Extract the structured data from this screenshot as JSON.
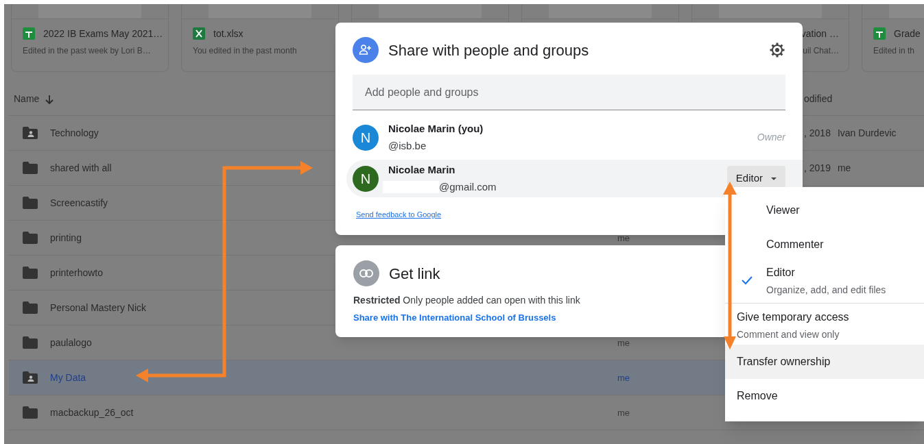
{
  "file_cards": [
    {
      "kind": "sheets_file",
      "title": "2022 IB Exams May 2021…",
      "subtitle": "Edited in the past week by Lori B…"
    },
    {
      "kind": "excel_file",
      "title": "tot.xlsx",
      "subtitle": "You edited in the past month"
    },
    {
      "kind": "covered"
    },
    {
      "kind": "covered"
    },
    {
      "kind": "partial",
      "title": "vation …",
      "subtitle": "uil Chat…"
    },
    {
      "kind": "sheets_file",
      "title": "Grade",
      "subtitle": "Edited in th"
    }
  ],
  "columns": [
    {
      "label": "Name",
      "sorted": true
    },
    {
      "label": "odified",
      "sorted": false
    }
  ],
  "rows": [
    {
      "name": "Technology",
      "kind": "shared_folder",
      "selected": false,
      "modified": ", 2018",
      "modified_by": "Ivan Durdevic"
    },
    {
      "name": "shared with all",
      "kind": "folder",
      "selected": false,
      "modified": ", 2019",
      "modified_by": "me"
    },
    {
      "name": "Screencastify",
      "kind": "folder",
      "selected": false
    },
    {
      "name": "printing",
      "kind": "folder",
      "selected": false,
      "owner": "me"
    },
    {
      "name": "printerhowto",
      "kind": "folder",
      "selected": false
    },
    {
      "name": "Personal Mastery Nick",
      "kind": "folder",
      "selected": false
    },
    {
      "name": "paulalogo",
      "kind": "folder",
      "selected": false,
      "owner": "me"
    },
    {
      "name": "My Data",
      "kind": "shared_folder",
      "selected": true,
      "owner": "me"
    },
    {
      "name": "macbackup_26_oct",
      "kind": "folder",
      "selected": false,
      "owner": "me"
    }
  ],
  "share_dialog": {
    "title": "Share with people and groups",
    "add_field": {
      "placeholder": "Add people and groups"
    },
    "people": [
      {
        "initial": "N",
        "color": "#1a88d6",
        "name": "Nicolae Marin (you)",
        "email": "@isb.be",
        "kind": "owner",
        "role": "Owner",
        "selected": false
      },
      {
        "initial": "N",
        "color": "#2d6a1f",
        "name": "Nicolae Marin",
        "email": "@gmail.com",
        "email_redacted": true,
        "kind": "collaborator",
        "role": "Editor",
        "selected": true
      }
    ],
    "feedback_link": "Send feedback to Google"
  },
  "link_dialog": {
    "title": "Get link",
    "description": "**Restricted** Only people added can open with this link",
    "share_link": "Share with The International School of Brussels"
  },
  "role_menu": {
    "items": [
      {
        "kind": "role",
        "label": "Viewer",
        "selected": false,
        "highlighted": false,
        "divider_before": false
      },
      {
        "kind": "role",
        "label": "Commenter",
        "selected": false,
        "highlighted": false,
        "divider_before": false
      },
      {
        "kind": "role",
        "label": "Editor",
        "description": "Organize, add, and edit files",
        "selected": true,
        "highlighted": false,
        "divider_before": false
      },
      {
        "kind": "action",
        "label": "Give temporary access",
        "description": "Comment and view only",
        "selected": false,
        "highlighted": false,
        "divider_before": true
      },
      {
        "kind": "action",
        "label": "Transfer ownership",
        "selected": false,
        "highlighted": true,
        "divider_before": false
      },
      {
        "kind": "action",
        "label": "Remove",
        "selected": false,
        "highlighted": false,
        "divider_before": false
      }
    ]
  }
}
